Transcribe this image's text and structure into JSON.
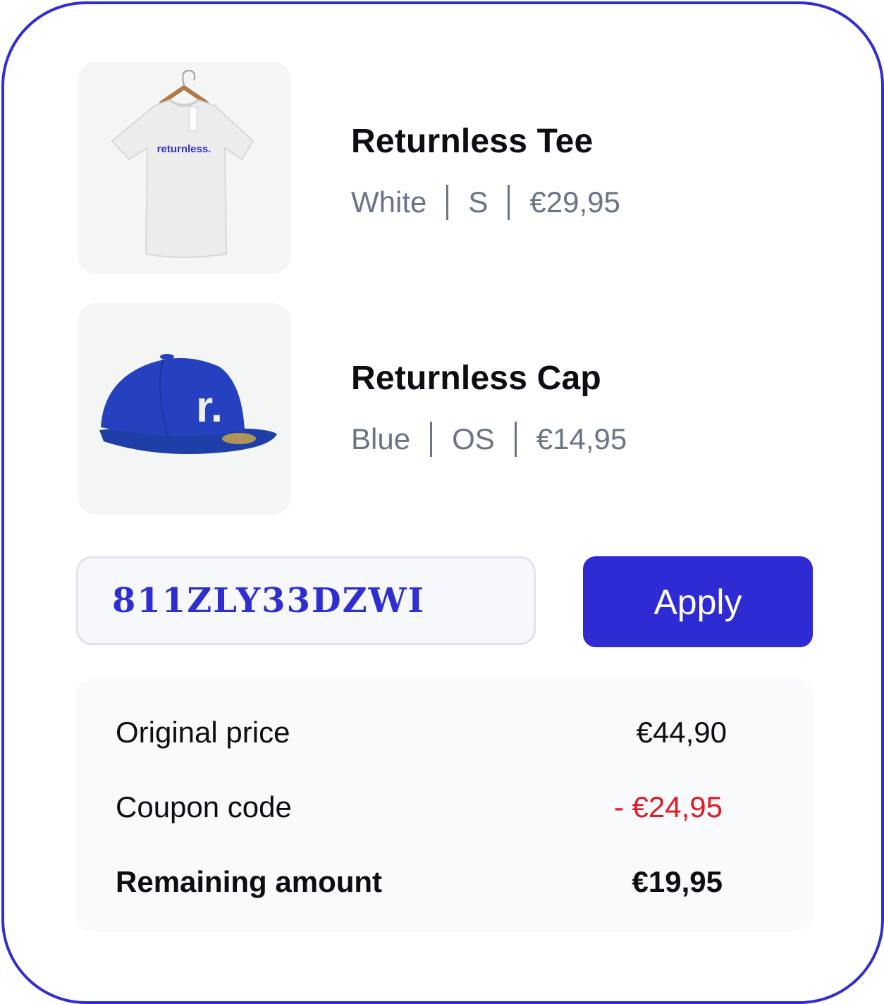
{
  "products": [
    {
      "name": "Returnless Tee",
      "color": "White",
      "size": "S",
      "price": "€29,95",
      "image": "tshirt-image",
      "print_text": "returnless."
    },
    {
      "name": "Returnless Cap",
      "color": "Blue",
      "size": "OS",
      "price": "€14,95",
      "image": "cap-image",
      "print_text": "r."
    }
  ],
  "coupon": {
    "code": "811ZLY33DZWI",
    "apply_label": "Apply"
  },
  "summary": {
    "original_label": "Original price",
    "original_value": "€44,90",
    "coupon_label": "Coupon code",
    "coupon_value": "- €24,95",
    "remaining_label": "Remaining amount",
    "remaining_value": "€19,95"
  },
  "colors": {
    "accent": "#2e2ad4",
    "border": "#2f2fd1",
    "discount": "#e01b24",
    "muted_text": "#6b7486"
  }
}
